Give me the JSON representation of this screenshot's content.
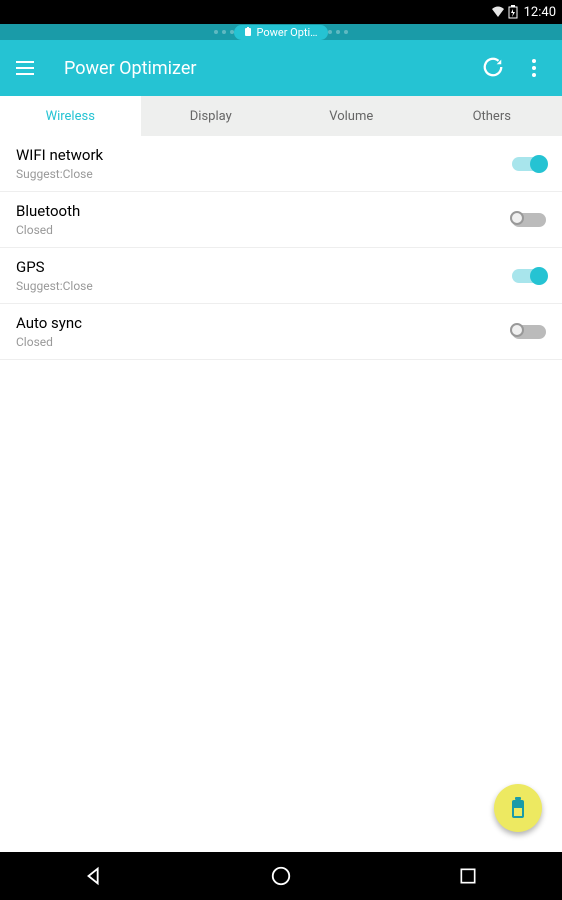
{
  "status": {
    "time": "12:40"
  },
  "notification": {
    "label": "Power Opti…"
  },
  "appbar": {
    "title": "Power Optimizer"
  },
  "tabs": [
    {
      "label": "Wireless",
      "active": true
    },
    {
      "label": "Display",
      "active": false
    },
    {
      "label": "Volume",
      "active": false
    },
    {
      "label": "Others",
      "active": false
    }
  ],
  "items": [
    {
      "title": "WIFI network",
      "subtitle": "Suggest:Close",
      "on": true
    },
    {
      "title": "Bluetooth",
      "subtitle": "Closed",
      "on": false
    },
    {
      "title": "GPS",
      "subtitle": "Suggest:Close",
      "on": true
    },
    {
      "title": "Auto sync",
      "subtitle": "Closed",
      "on": false
    }
  ]
}
